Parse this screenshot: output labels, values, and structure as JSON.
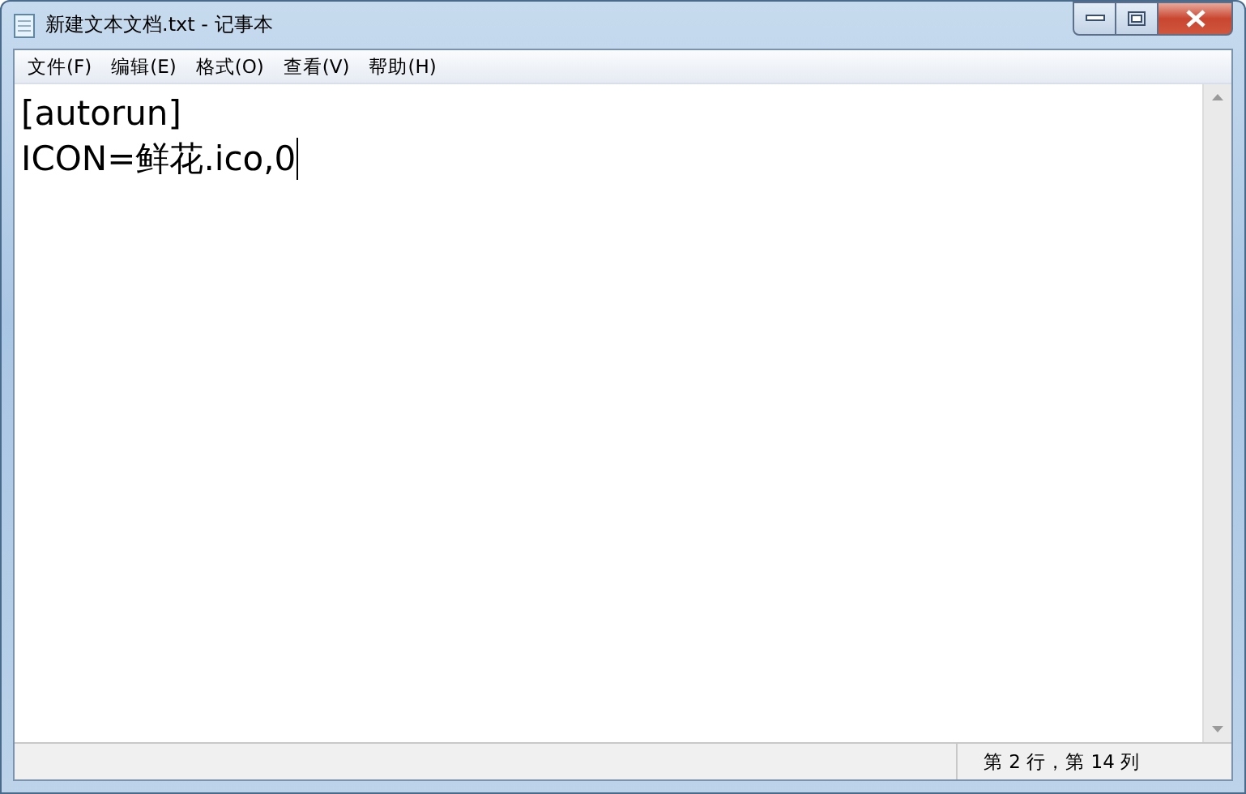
{
  "window": {
    "title": "新建文本文档.txt - 记事本"
  },
  "menu": [
    "文件(F)",
    "编辑(E)",
    "格式(O)",
    "查看(V)",
    "帮助(H)"
  ],
  "editor": {
    "lines": [
      "[autorun]",
      "ICON=鲜花.ico,0"
    ]
  },
  "status_bar": {
    "position": "第 2 行，第 14 列"
  }
}
